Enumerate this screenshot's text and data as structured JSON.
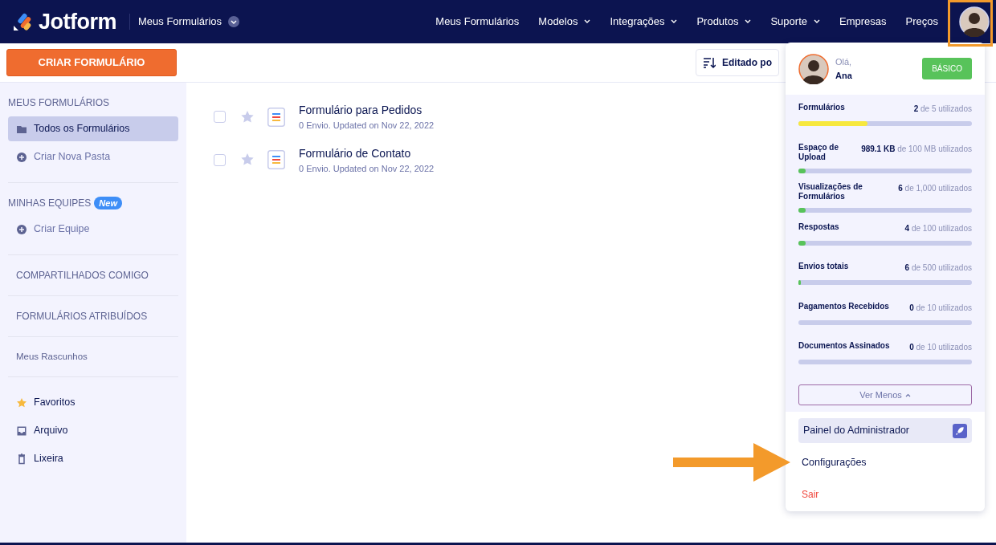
{
  "navbar": {
    "brand": "Jotform",
    "workspace": "Meus Formulários",
    "menu": [
      {
        "label": "Meus Formulários",
        "dropdown": false
      },
      {
        "label": "Modelos",
        "dropdown": true
      },
      {
        "label": "Integrações",
        "dropdown": true
      },
      {
        "label": "Produtos",
        "dropdown": true
      },
      {
        "label": "Suporte",
        "dropdown": true
      },
      {
        "label": "Empresas",
        "dropdown": false
      },
      {
        "label": "Preços",
        "dropdown": false
      }
    ]
  },
  "toolbar": {
    "create_button": "CRIAR FORMULÁRIO",
    "sort_button": "Editado po"
  },
  "sidebar": {
    "groups": [
      {
        "title": "MEUS FORMULÁRIOS",
        "items": [
          {
            "label": "Todos os Formulários",
            "kind": "folder",
            "selected": true
          },
          {
            "label": "Criar Nova Pasta",
            "kind": "add",
            "selected": false
          }
        ]
      },
      {
        "title": "MINHAS EQUIPES",
        "badge": "New",
        "items": [
          {
            "label": "Criar Equipe",
            "kind": "add",
            "selected": false
          }
        ]
      },
      {
        "link": "COMPARTILHADOS COMIGO"
      },
      {
        "link": "FORMULÁRIOS ATRIBUÍDOS"
      },
      {
        "link": "Meus Rascunhos"
      },
      {
        "items": [
          {
            "label": "Favoritos",
            "kind": "favorite",
            "selected": false
          },
          {
            "label": "Arquivo",
            "kind": "archive",
            "selected": false
          },
          {
            "label": "Lixeira",
            "kind": "trash",
            "selected": false
          }
        ]
      }
    ]
  },
  "forms": [
    {
      "title": "Formulário para Pedidos",
      "meta": "0 Envio. Updated on Nov 22, 2022",
      "checked": false,
      "starred": false
    },
    {
      "title": "Formulário de Contato",
      "meta": "0 Envio. Updated on Nov 22, 2022",
      "checked": false,
      "starred": false
    }
  ],
  "account_menu": {
    "greeting": "Olá,",
    "name": "Ana",
    "plan": "BÁSICO",
    "usage": [
      {
        "label": "Formulários",
        "used": "2",
        "limit": "de 5 utilizados",
        "level": 0.4,
        "color": "#f7e83e"
      },
      {
        "label": "Espaço de Upload",
        "used": "989.1 KB",
        "limit": "de 100 MB utilizados",
        "level": 0.04,
        "color": "#58c35a"
      },
      {
        "label": "Visualizações de Formulários",
        "used": "6",
        "limit": "de 1,000 utilizados",
        "level": 0.04,
        "color": "#58c35a"
      },
      {
        "label": "Respostas",
        "used": "4",
        "limit": "de 100 utilizados",
        "level": 0.04,
        "color": "#58c35a"
      },
      {
        "label": "Envios totais",
        "used": "6",
        "limit": "de 500 utilizados",
        "level": 0.01,
        "color": "#58c35a"
      },
      {
        "label": "Pagamentos Recebidos",
        "used": "0",
        "limit": "de 10 utilizados"
      },
      {
        "label": "Documentos Assinados",
        "used": "0",
        "limit": "de 10 utilizados"
      }
    ],
    "toggle": "Ver Menos",
    "items": [
      {
        "label": "Painel do Administrador",
        "kind": "admin"
      },
      {
        "label": "Configurações",
        "kind": "plain"
      },
      {
        "label": "Sair",
        "kind": "danger"
      }
    ]
  },
  "annotation": {
    "highlight_avatar": true,
    "arrow": true
  }
}
